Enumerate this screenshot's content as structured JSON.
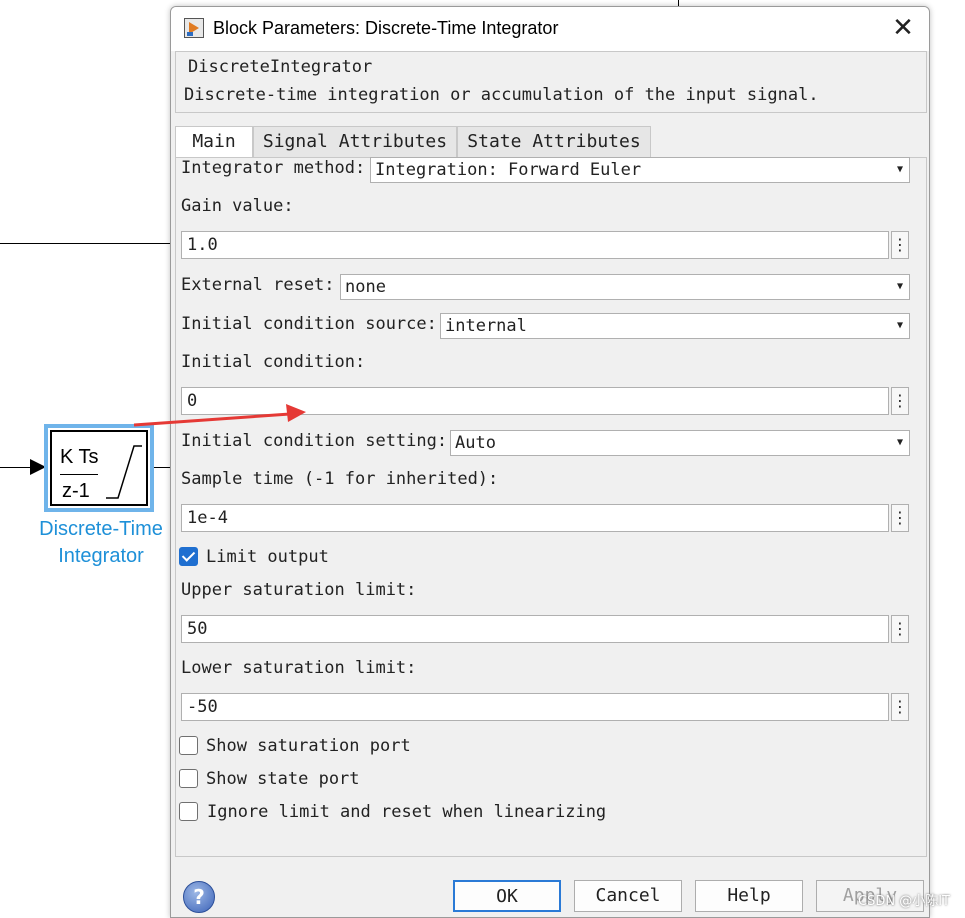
{
  "canvas": {
    "block": {
      "numerator": "K Ts",
      "denominator": "z-1",
      "label_line1": "Discrete-Time",
      "label_line2": "Integrator"
    }
  },
  "dialog": {
    "title": "Block Parameters: Discrete-Time Integrator",
    "description_title": "DiscreteIntegrator",
    "description_text": "Discrete-time integration or accumulation of the input signal.",
    "tabs": [
      {
        "label": "Main",
        "active": true
      },
      {
        "label": "Signal Attributes",
        "active": false
      },
      {
        "label": "State Attributes",
        "active": false
      }
    ],
    "params": {
      "integrator_method_label": "Integrator method:",
      "integrator_method_value": "Integration: Forward Euler",
      "gain_value_label": "Gain value:",
      "gain_value": "1.0",
      "external_reset_label": "External reset:",
      "external_reset_value": "none",
      "ic_source_label": "Initial condition source:",
      "ic_source_value": "internal",
      "initial_condition_label": "Initial condition:",
      "initial_condition": "0",
      "ic_setting_label": "Initial condition setting:",
      "ic_setting_value": "Auto",
      "sample_time_label": "Sample time (-1 for inherited):",
      "sample_time": "1e-4",
      "limit_output_label": "Limit output",
      "limit_output_checked": true,
      "upper_label": "Upper saturation limit:",
      "upper_value": "50",
      "lower_label": "Lower saturation limit:",
      "lower_value": "-50",
      "show_sat_port_label": "Show saturation port",
      "show_state_port_label": "Show state port",
      "ignore_limit_label": "Ignore limit and reset when linearizing"
    },
    "buttons": {
      "ok": "OK",
      "cancel": "Cancel",
      "help": "Help",
      "apply": "Apply"
    },
    "help_icon": "?"
  },
  "watermark": "CSDN @小陈IT",
  "colors": {
    "accent": "#1f6fd0",
    "block_label": "#1e90d8",
    "annotation_arrow": "#e53935"
  }
}
